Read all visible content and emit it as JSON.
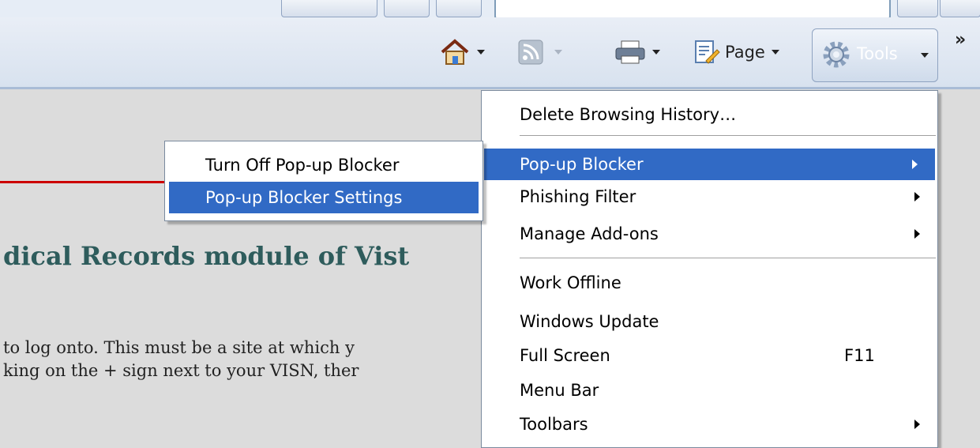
{
  "command_bar": {
    "home_icon": "home-icon",
    "feeds_icon": "feeds-icon",
    "print_icon": "print-icon",
    "page_icon": "page-icon",
    "page_label": "Page",
    "tools_icon": "gear-icon",
    "tools_label": "Tools",
    "overflow_label": "»"
  },
  "content": {
    "heading": "dical Records module of Vist",
    "line1": "to log onto. This must be a site at which y",
    "line2": "king on the + sign next to your VISN, ther"
  },
  "tools_menu": {
    "delete_history": "Delete Browsing History…",
    "popup_blocker": "Pop-up Blocker",
    "phishing_filter": "Phishing Filter",
    "manage_addons": "Manage Add-ons",
    "work_offline": "Work Offline",
    "windows_update": "Windows Update",
    "full_screen": "Full Screen",
    "full_screen_shortcut": "F11",
    "menu_bar": "Menu Bar",
    "toolbars": "Toolbars"
  },
  "popup_submenu": {
    "turn_off": "Turn Off Pop-up Blocker",
    "settings": "Pop-up Blocker Settings"
  },
  "colors": {
    "highlight": "#316ac5",
    "heading": "#2e5c5c",
    "rule": "#cc0000"
  }
}
